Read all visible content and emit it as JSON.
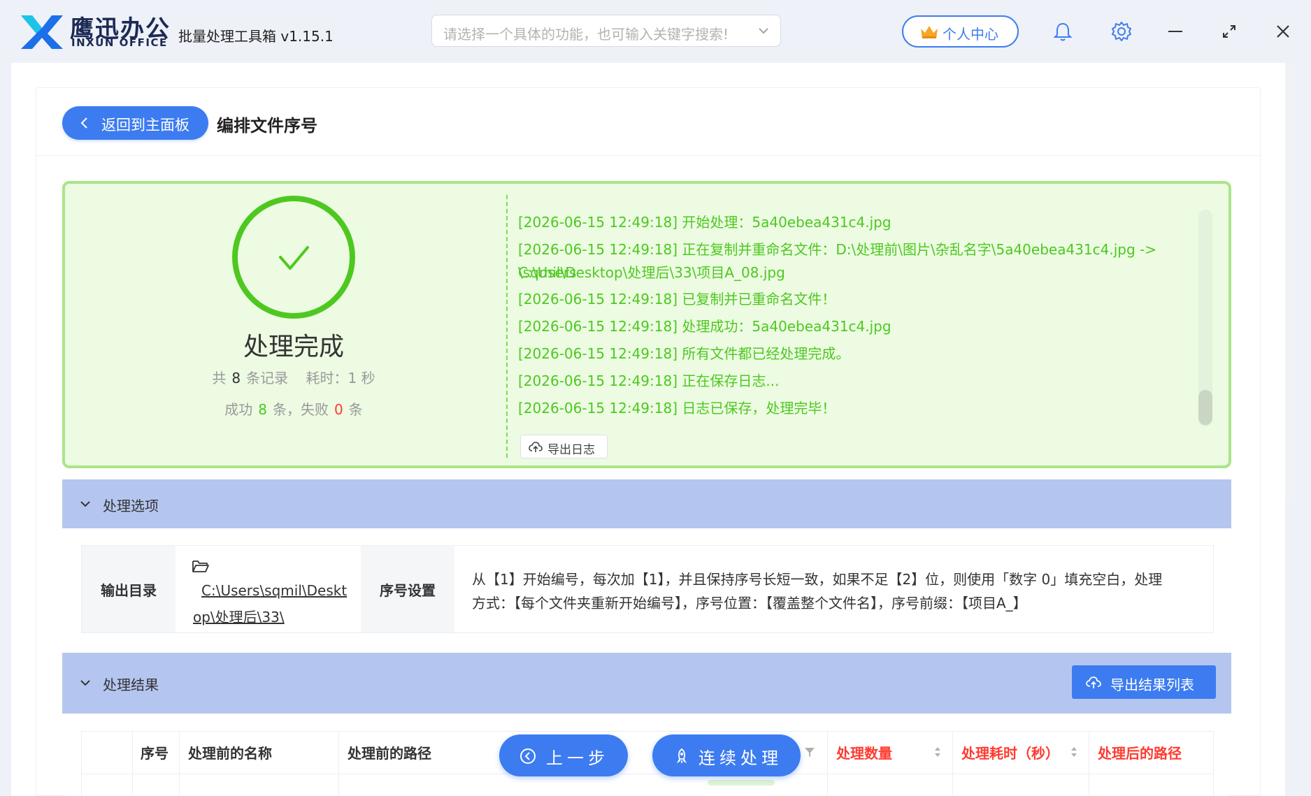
{
  "app": {
    "logo_cn": "鹰迅办公",
    "logo_en": "INXUN OFFICE",
    "title": "批量处理工具箱 v1.15.1",
    "search_placeholder": "请选择一个具体的功能，也可输入关键字搜索!",
    "personal_center": "个人中心",
    "icons": [
      "bell-icon",
      "gear-icon",
      "minimize-icon",
      "maximize-icon",
      "close-icon"
    ]
  },
  "page": {
    "back_label": "返回到主面板",
    "title": "编排文件序号"
  },
  "status": {
    "title": "处理完成",
    "total_prefix": "共",
    "total_count": "8",
    "total_suffix": "条记录",
    "time_label": "耗时：",
    "time_value": "1",
    "time_unit": "秒",
    "success_label": "成功",
    "success_count": "8",
    "success_suffix": "条，失败",
    "fail_count": "0",
    "fail_suffix": "条",
    "export_log": "导出日志"
  },
  "log_lines": [
    "[2026-06-15 12:49:18] 开始处理：5a40ebea431c4.jpg",
    "[2026-06-15 12:49:18] 正在复制并重命名文件：D:\\处理前\\图片\\杂乱名字\\5a40ebea431c4.jpg -> C:\\Users",
    "\\sqmil\\Desktop\\处理后\\33\\项目A_08.jpg",
    "[2026-06-15 12:49:18] 已复制并已重命名文件！",
    "[2026-06-15 12:49:18] 处理成功：5a40ebea431c4.jpg",
    "[2026-06-15 12:49:18] 所有文件都已经处理完成。",
    "[2026-06-15 12:49:18] 正在保存日志...",
    "[2026-06-15 12:49:18] 日志已保存，处理完毕！"
  ],
  "options": {
    "section_title": "处理选项",
    "output_dir_label": "输出目录",
    "output_dir_line1": "C:\\Users\\sqmil\\Deskt",
    "output_dir_line2": "op\\处理后\\33\\",
    "seq_label": "序号设置",
    "seq_line1": "从【1】开始编号，每次加【1】，并且保持序号长短一致，如果不足【2】位，则使用「数字 0」填充空白，处理",
    "seq_line2": "方式：【每个文件夹重新开始编号】，序号位置：【覆盖整个文件名】，序号前缀：【项目A_】"
  },
  "results": {
    "section_title": "处理结果",
    "export_label": "导出结果列表",
    "columns": [
      "序号",
      "处理前的名称",
      "处理前的路径",
      "处理数量",
      "处理耗时（秒）",
      "处理后的路径"
    ],
    "prev_step": "上一步",
    "continue": "连续处理"
  },
  "colors": {
    "accent": "#3d7cf0",
    "success_green": "#4ec820",
    "error_red": "#ff3b30",
    "panel_bg": "#ecfbe2",
    "section_header": "#b4c6f0"
  }
}
